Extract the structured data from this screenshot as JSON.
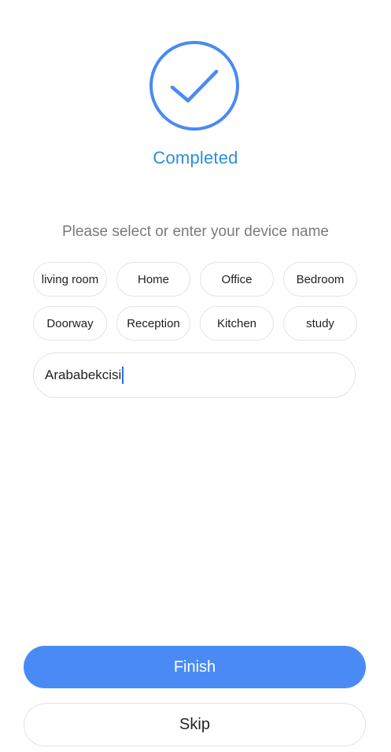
{
  "status": {
    "icon": "check-circle-icon",
    "title": "Completed",
    "accent_color": "#2a8fd8"
  },
  "prompt": "Please select or enter your device name",
  "name_chips": [
    "living room",
    "Home",
    "Office",
    "Bedroom",
    "Doorway",
    "Reception",
    "Kitchen",
    "study"
  ],
  "device_name_input": {
    "value": "Arababekcisi"
  },
  "buttons": {
    "finish_label": "Finish",
    "finish_color": "#4a8af4",
    "skip_label": "Skip"
  }
}
